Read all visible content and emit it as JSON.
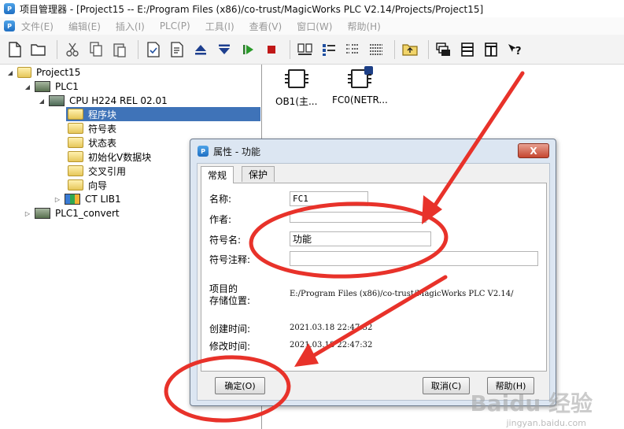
{
  "window": {
    "title": "项目管理器 - [Project15 -- E:/Program Files (x86)/co-trust/MagicWorks PLC V2.14/Projects/Project15]"
  },
  "menu": {
    "items": [
      "文件(E)",
      "编辑(E)",
      "插入(I)",
      "PLC(P)",
      "工具(I)",
      "查看(V)",
      "窗口(W)",
      "帮助(H)"
    ]
  },
  "toolbar": {
    "icons": [
      "new-file-icon",
      "open-folder-icon",
      "cut-icon",
      "copy-icon",
      "paste-icon",
      "check-icon",
      "compile-icon",
      "upload-icon",
      "download-icon",
      "run-icon",
      "stop-icon",
      "large-icons-icon",
      "small-icons-icon",
      "list-icon",
      "details-icon",
      "folder-up-icon",
      "cascade-icon",
      "tile-horizontal-icon",
      "tile-vertical-icon",
      "help-icon"
    ]
  },
  "tree": {
    "items": [
      {
        "label": "Project15"
      },
      {
        "label": "PLC1"
      },
      {
        "label": "CPU H224 REL 02.01"
      },
      {
        "label": "程序块"
      },
      {
        "label": "符号表"
      },
      {
        "label": "状态表"
      },
      {
        "label": "初始化V数据块"
      },
      {
        "label": "交叉引用"
      },
      {
        "label": "向导"
      },
      {
        "label": "CT LIB1"
      },
      {
        "label": "PLC1_convert"
      }
    ]
  },
  "blocks": [
    {
      "label": "OB1(主..."
    },
    {
      "label": "FC0(NETR..."
    }
  ],
  "dialog": {
    "title": "属性 - 功能",
    "close_label": "X",
    "tabs": [
      "常规",
      "保护"
    ],
    "name_label": "名称:",
    "name_value": "FC1",
    "author_label": "作者:",
    "author_value": "",
    "symbol_label": "符号名:",
    "symbol_value": "功能",
    "comment_label": "符号注释:",
    "comment_value": "",
    "location_label_1": "项目的",
    "location_label_2": "存储位置:",
    "location_value": "E:/Program Files (x86)/co-trust/MagicWorks PLC V2.14/",
    "created_label": "创建时间:",
    "created_value": "2021.03.18  22:47:32",
    "modified_label": "修改时间:",
    "modified_value": "2021.03.18  22:47:32",
    "ok_label": "确定(O)",
    "cancel_label": "取消(C)",
    "help_label": "帮助(H)"
  },
  "watermark": {
    "text": "Baidu 经验",
    "url": "jingyan.baidu.com"
  },
  "colors": {
    "selection": "#3f73b8",
    "annotation": "#e8322a",
    "close": "#c5462f"
  }
}
